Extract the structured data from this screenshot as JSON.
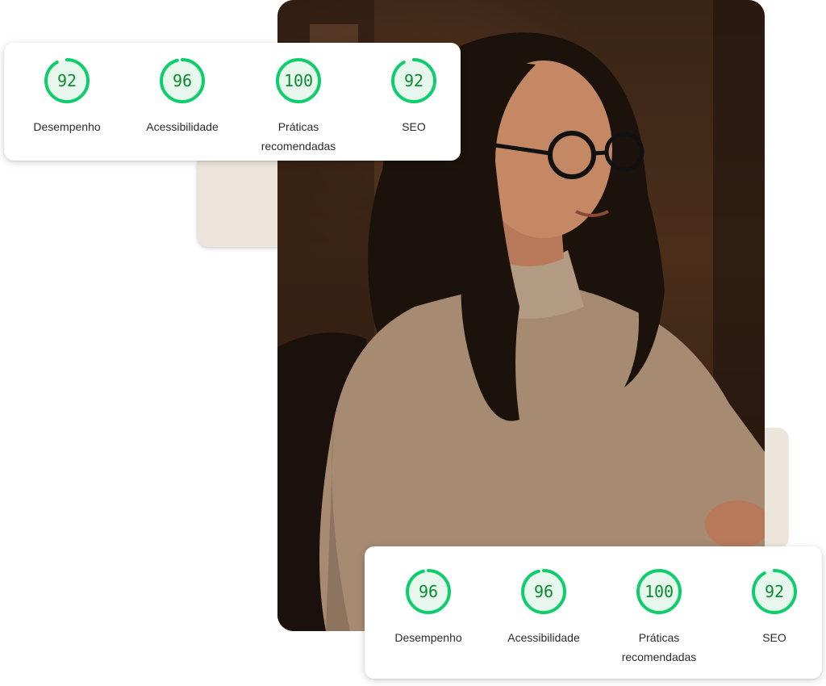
{
  "colors": {
    "gauge_green": "#0cce6b",
    "gauge_fill": "#e8f7ee",
    "gauge_text": "#0a8a2e",
    "beige": "#ece5db"
  },
  "photo": {
    "subject": "woman with glasses in knit sweater at desk"
  },
  "card_top": {
    "metrics": [
      {
        "value": "92",
        "score": 92,
        "label": "Desempenho"
      },
      {
        "value": "96",
        "score": 96,
        "label": "Acessibilidade"
      },
      {
        "value": "100",
        "score": 100,
        "label": "Práticas\nrecomendadas"
      },
      {
        "value": "92",
        "score": 92,
        "label": "SEO"
      }
    ]
  },
  "card_bottom": {
    "metrics": [
      {
        "value": "96",
        "score": 96,
        "label": "Desempenho"
      },
      {
        "value": "96",
        "score": 96,
        "label": "Acessibilidade"
      },
      {
        "value": "100",
        "score": 100,
        "label": "Práticas\nrecomendadas"
      },
      {
        "value": "92",
        "score": 92,
        "label": "SEO"
      }
    ]
  }
}
